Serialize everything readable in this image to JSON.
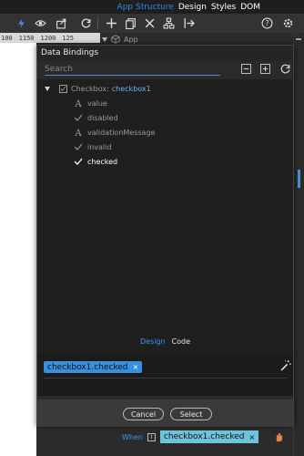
{
  "header": {
    "tabs": [
      "App Structure",
      "Design",
      "Styles",
      "DOM"
    ],
    "active_tab": "App Structure"
  },
  "ruler": [
    "100",
    "1150",
    "1200",
    "125"
  ],
  "app_node_label": "App",
  "dialog": {
    "title": "Data Bindings",
    "search_placeholder": "Search",
    "tree": {
      "root_type": "Checkbox:",
      "root_name": "checkbox1",
      "children": [
        "value",
        "disabled",
        "validationMessage",
        "invalid",
        "checked"
      ]
    },
    "tabs": {
      "design": "Design",
      "code": "Code"
    },
    "expression_token": "checkbox1.checked",
    "token_remove": "×",
    "buttons": {
      "cancel": "Cancel",
      "select": "Select"
    }
  },
  "when_row": {
    "label": "When",
    "info": "i",
    "token": "checkbox1.checked",
    "remove": "×"
  },
  "colors": {
    "accent": "#2b8be6",
    "token_bg": "#3a8fdc",
    "when_token_bg": "#6fc3d9"
  }
}
